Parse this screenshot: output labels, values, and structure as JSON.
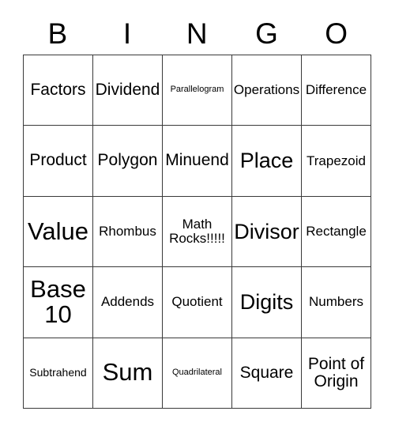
{
  "card": {
    "type": "bingo-card",
    "header_letters": [
      "B",
      "I",
      "N",
      "G",
      "O"
    ],
    "columns": 5,
    "rows": 5,
    "border_color": "#3a3a3a",
    "background_color": "#ffffff",
    "text_color": "#000000"
  },
  "cells": [
    {
      "text": "Factors",
      "size": "md",
      "row": 1,
      "col": 1
    },
    {
      "text": "Dividend",
      "size": "md",
      "row": 1,
      "col": 2
    },
    {
      "text": "Parallelogram",
      "size": "xxs",
      "row": 1,
      "col": 3
    },
    {
      "text": "Operations",
      "size": "sm",
      "row": 1,
      "col": 4
    },
    {
      "text": "Difference",
      "size": "sm",
      "row": 1,
      "col": 5
    },
    {
      "text": "Product",
      "size": "md",
      "row": 2,
      "col": 1
    },
    {
      "text": "Polygon",
      "size": "md",
      "row": 2,
      "col": 2
    },
    {
      "text": "Minuend",
      "size": "md",
      "row": 2,
      "col": 3
    },
    {
      "text": "Place",
      "size": "lg",
      "row": 2,
      "col": 4
    },
    {
      "text": "Trapezoid",
      "size": "sm",
      "row": 2,
      "col": 5
    },
    {
      "text": "Value",
      "size": "xl",
      "row": 3,
      "col": 1
    },
    {
      "text": "Rhombus",
      "size": "sm",
      "row": 3,
      "col": 2
    },
    {
      "text": "Math Rocks!!!!!",
      "size": "sm",
      "row": 3,
      "col": 3
    },
    {
      "text": "Divisor",
      "size": "lg",
      "row": 3,
      "col": 4
    },
    {
      "text": "Rectangle",
      "size": "sm",
      "row": 3,
      "col": 5
    },
    {
      "text": "Base 10",
      "size": "xl",
      "row": 4,
      "col": 1
    },
    {
      "text": "Addends",
      "size": "sm",
      "row": 4,
      "col": 2
    },
    {
      "text": "Quotient",
      "size": "sm",
      "row": 4,
      "col": 3
    },
    {
      "text": "Digits",
      "size": "lg",
      "row": 4,
      "col": 4
    },
    {
      "text": "Numbers",
      "size": "sm",
      "row": 4,
      "col": 5
    },
    {
      "text": "Subtrahend",
      "size": "xs",
      "row": 5,
      "col": 1
    },
    {
      "text": "Sum",
      "size": "xl",
      "row": 5,
      "col": 2
    },
    {
      "text": "Quadrilateral",
      "size": "xxs",
      "row": 5,
      "col": 3
    },
    {
      "text": "Square",
      "size": "md",
      "row": 5,
      "col": 4
    },
    {
      "text": "Point of Origin",
      "size": "md",
      "row": 5,
      "col": 5
    }
  ]
}
